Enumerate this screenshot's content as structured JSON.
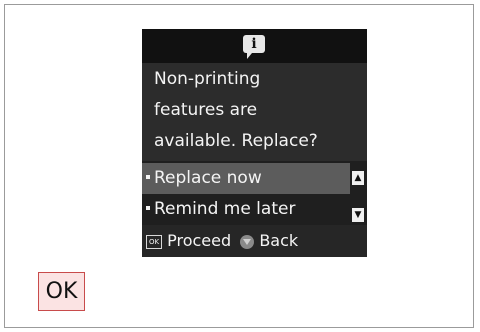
{
  "screen": {
    "icon": "info-icon",
    "message_lines": [
      "Non-printing",
      "features are",
      "available. Replace?"
    ],
    "options": [
      {
        "label": "Replace now",
        "selected": true
      },
      {
        "label": "Remind me later",
        "selected": false
      }
    ],
    "scroll_up_glyph": "▲",
    "scroll_down_glyph": "▼",
    "footer": {
      "ok_key": "OK",
      "proceed_label": "Proceed",
      "back_label": "Back"
    }
  },
  "button_badge": {
    "label": "OK"
  }
}
